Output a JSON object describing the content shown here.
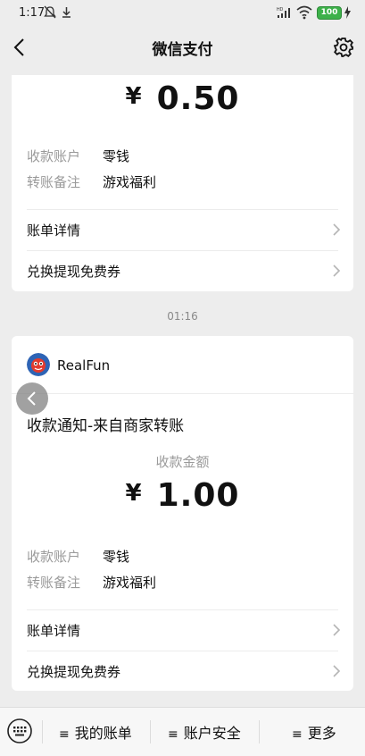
{
  "status_bar": {
    "time": "1:17",
    "battery": "100"
  },
  "nav": {
    "title": "微信支付"
  },
  "card1": {
    "currency": "¥",
    "amount": "0.50",
    "fields": [
      {
        "label": "收款账户",
        "value": "零钱"
      },
      {
        "label": "转账备注",
        "value": "游戏福利"
      }
    ],
    "rows": [
      "账单详情",
      "兑换提现免费券"
    ]
  },
  "timestamp": "01:16",
  "card2": {
    "merchant": "RealFun",
    "title": "收款通知-来自商家转账",
    "amount_label": "收款金额",
    "currency": "¥",
    "amount": "1.00",
    "fields": [
      {
        "label": "收款账户",
        "value": "零钱"
      },
      {
        "label": "转账备注",
        "value": "游戏福利"
      }
    ],
    "rows": [
      "账单详情",
      "兑换提现免费券"
    ]
  },
  "bottom_bar": {
    "tabs": [
      "我的账单",
      "账户安全",
      "更多"
    ],
    "icons": [
      "keyboard-icon",
      "menu-icon"
    ]
  },
  "colors": {
    "accent_green": "#3db14a",
    "background": "#ededed",
    "muted_text": "#9a9a9a"
  }
}
